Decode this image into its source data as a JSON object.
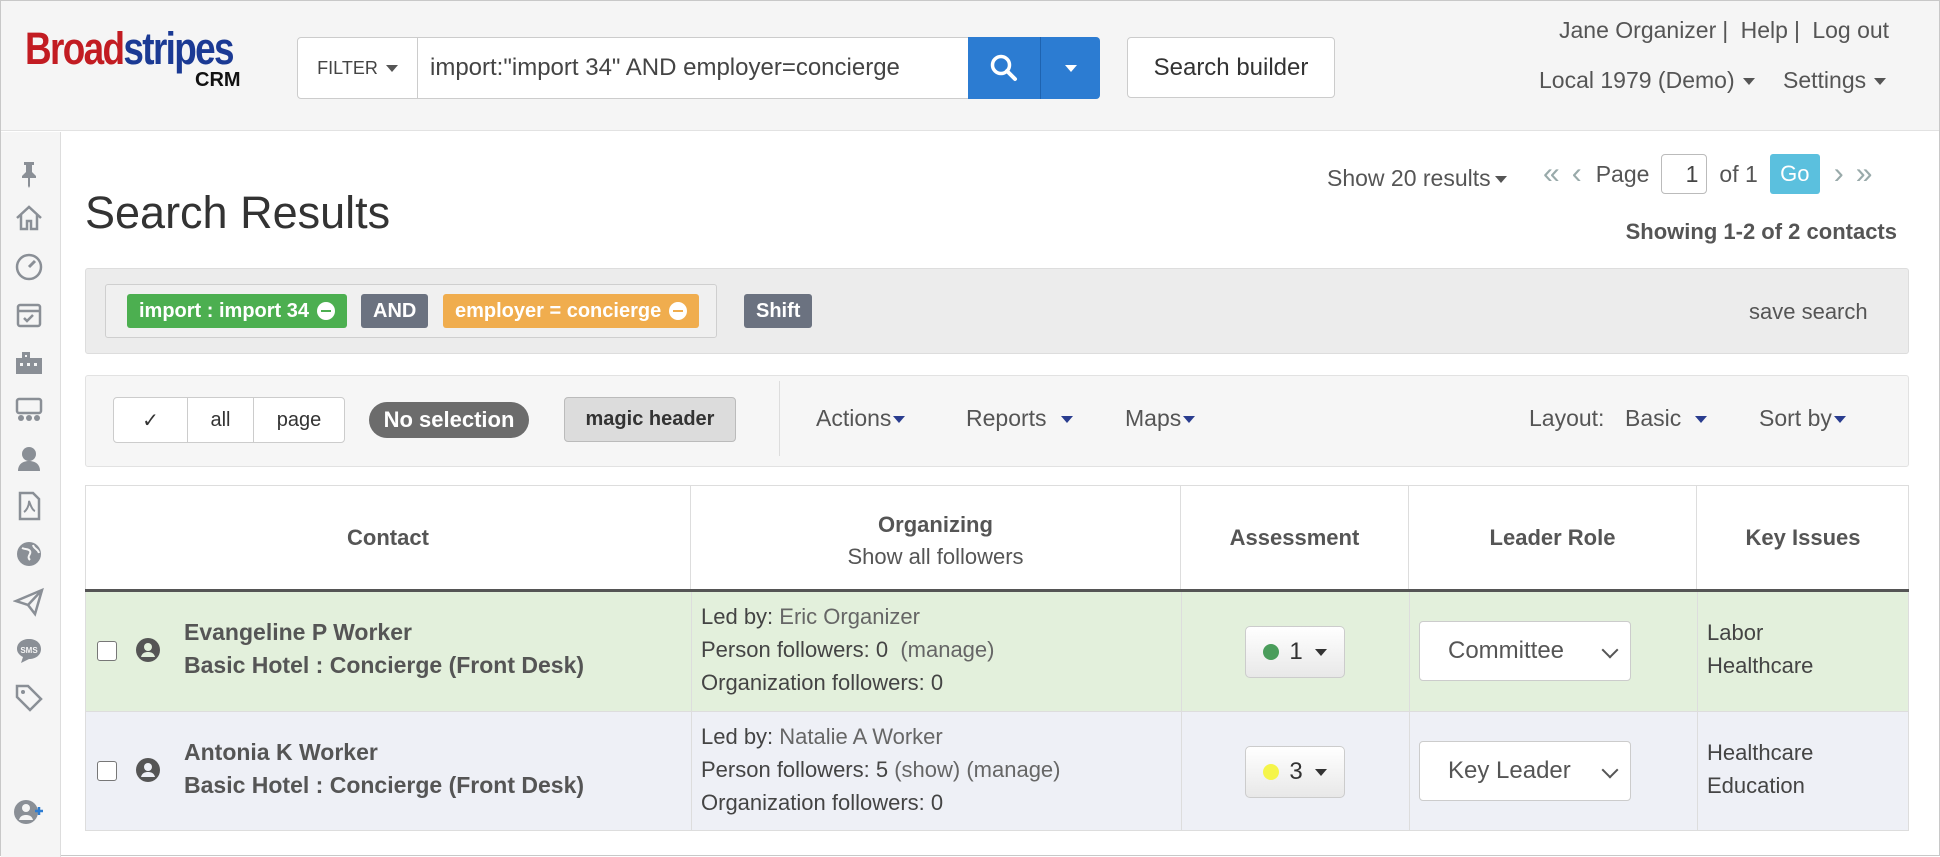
{
  "brand": {
    "name_red1": "Broad",
    "name_blue": "stripes",
    "name_red2": "",
    "suffix": "CRM"
  },
  "search": {
    "filter_label": "FILTER",
    "query": "import:\"import 34\" AND employer=concierge",
    "builder_label": "Search builder"
  },
  "user": {
    "name": "Jane Organizer",
    "help": "Help",
    "logout": "Log out",
    "org": "Local 1979 (Demo)",
    "settings": "Settings"
  },
  "sidebar": {
    "icons": [
      "pin-icon",
      "home-icon",
      "dashboard-icon",
      "calendar-icon",
      "building-icon",
      "organizing-icon",
      "support-icon",
      "pdf-icon",
      "globe-icon",
      "send-icon",
      "sms-icon",
      "tag-icon",
      "add-person-icon"
    ]
  },
  "page": {
    "title": "Search Results",
    "show_results": "Show 20 results",
    "page_label": "Page",
    "page_value": "1",
    "of_label": "of 1",
    "go_label": "Go",
    "showing": "Showing 1-2 of 2 contacts"
  },
  "filters": {
    "chips": [
      {
        "label": "import : import 34",
        "color": "#4caf50"
      },
      {
        "label": "AND",
        "color": "#6b7280"
      },
      {
        "label": "employer = concierge",
        "color": "#f0ad4e"
      }
    ],
    "shift_label": "Shift",
    "save_search": "save search"
  },
  "toolbar": {
    "check_label": "✓",
    "all_label": "all",
    "page_label": "page",
    "no_selection": "No selection",
    "magic_header": "magic header",
    "actions": "Actions",
    "reports": "Reports",
    "maps": "Maps",
    "layout_label": "Layout:",
    "layout_value": "Basic",
    "sort_by": "Sort by"
  },
  "table": {
    "headers": {
      "contact": "Contact",
      "organizing": "Organizing",
      "organizing_sub": "Show all followers",
      "assessment": "Assessment",
      "leader_role": "Leader Role",
      "key_issues": "Key Issues"
    },
    "rows": [
      {
        "name": "Evangeline P Worker",
        "employer": "Basic Hotel : Concierge (Front Desk)",
        "led_by_label": "Led by:",
        "led_by": "Eric Organizer",
        "person_followers": "Person followers: 0",
        "person_links": "(manage)",
        "org_followers": "Organization followers: 0",
        "assessment": "1",
        "assessment_color": "#4a9d5b",
        "leader_role": "Committee",
        "issues": [
          "Labor",
          "Healthcare"
        ],
        "bg": "#e3f0dc"
      },
      {
        "name": "Antonia K Worker",
        "employer": "Basic Hotel : Concierge (Front Desk)",
        "led_by_label": "Led by:",
        "led_by": "Natalie A Worker",
        "person_followers": "Person followers: 5",
        "person_links": "(show) (manage)",
        "org_followers": "Organization followers: 0",
        "assessment": "3",
        "assessment_color": "#f5f54a",
        "leader_role": "Key Leader",
        "issues": [
          "Healthcare",
          "Education"
        ],
        "bg": "#eef0f6"
      }
    ]
  }
}
